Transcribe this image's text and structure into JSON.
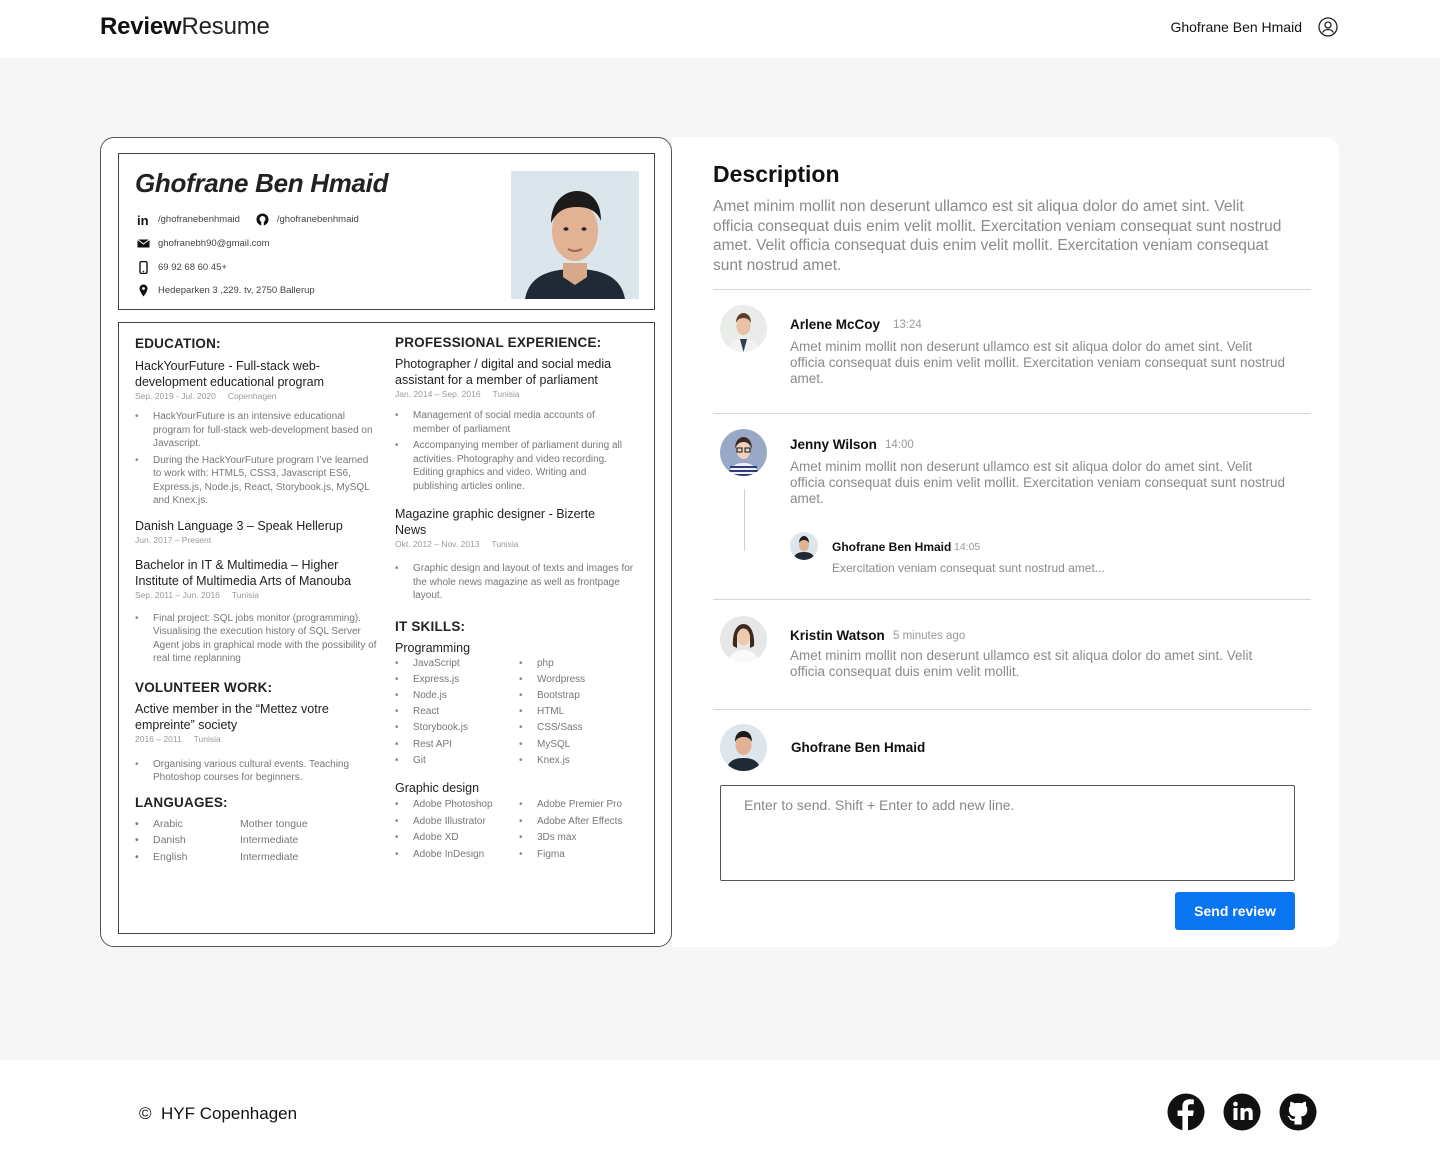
{
  "header": {
    "logo_bold": "Review",
    "logo_light": "Resume",
    "user_name": "Ghofrane Ben Hmaid"
  },
  "resume": {
    "name": "Ghofrane Ben Hmaid",
    "linkedin": "/ghofranebenhmaid",
    "github": "/ghofranebenhmaid",
    "email": "ghofranebh90@gmail.com",
    "phone": "69 92 68 60 45+",
    "address": "Hedeparken 3 ,229. tv, 2750 Ballerup",
    "education_title": "EDUCATION:",
    "edu1_title": "HackYourFuture - Full-stack web-development educational program",
    "edu1_date": "Sep. 2019 - Jul. 2020",
    "edu1_place": "Copenhagen",
    "edu1_b1": "HackYourFuture is an intensive educational program for full-stack web-development based on Javascript.",
    "edu1_b2": "During the HackYourFuture program I’ve learned to work with: HTML5, CSS3, Javascript ES6, Express.js, Node.js, React, Storybook.js, MySQL and Knex.js.",
    "edu2_title": "Danish Language 3 – Speak Hellerup",
    "edu2_date": "Jun. 2017 – Present",
    "edu3_title": "Bachelor in IT &  Multimedia – Higher Institute of Multimedia Arts of Manouba",
    "edu3_date": "Sep. 2011 – Jun. 2016",
    "edu3_place": "Tunisia",
    "edu3_b1": "Final project: SQL jobs monitor (programming). Visualising the execution history of SQL Server Agent jobs in graphical mode with the possibility of real time replanning",
    "volunteer_title": "VOLUNTEER WORK:",
    "vol_title": "Active member in the “Mettez votre empreinte” society",
    "vol_date": "2016 – 2011",
    "vol_place": "Tunisia",
    "vol_b1": "Organising various cultural events. Teaching Photoshop courses for beginners.",
    "languages_title": "LANGUAGES:",
    "languages": [
      {
        "lang": "Arabic",
        "level": "Mother tongue"
      },
      {
        "lang": "Danish",
        "level": "Intermediate"
      },
      {
        "lang": "English",
        "level": "Intermediate"
      }
    ],
    "experience_title": "PROFESSIONAL EXPERIENCE:",
    "exp1_title": "Photographer / digital and social media assistant for a member of parliament",
    "exp1_date": "Jan. 2014 – Sep. 2016",
    "exp1_place": "Tunisia",
    "exp1_b1": "Management of social media accounts of member of parliament",
    "exp1_b2": "Accompanying member of parliament during all activities. Photography and video recording. Editing graphics and video. Writing and publishing articles online.",
    "exp2_title": "Magazine graphic designer - Bizerte News",
    "exp2_date": "Okt. 2012 – Nov. 2013",
    "exp2_place": "Tunisia",
    "exp2_b1": "Graphic design and layout of texts and images for the whole news magazine as well as frontpage layout.",
    "skills_title": "IT SKILLS:",
    "programming_title": "Programming",
    "prog_col1": [
      "JavaScript",
      "Express.js",
      "Node.js",
      "React",
      "Storybook.js",
      "Rest API",
      "Git"
    ],
    "prog_col2": [
      "php",
      "Wordpress",
      "Bootstrap",
      "HTML",
      "CSS/Sass",
      "MySQL",
      "Knex.js"
    ],
    "graphic_title": "Graphic design",
    "gfx_col1": [
      "Adobe Photoshop",
      "Adobe Illustrator",
      "Adobe XD",
      "Adobe InDesign"
    ],
    "gfx_col2": [
      "Adobe Premier Pro",
      "Adobe After Effects",
      "3Ds max",
      "Figma"
    ]
  },
  "review": {
    "description_title": "Description",
    "description_text": "Amet minim mollit non deserunt ullamco est sit aliqua dolor do amet sint. Velit officia consequat duis enim velit mollit. Exercitation veniam consequat sunt nostrud amet. Velit officia consequat duis enim velit mollit. Exercitation veniam consequat sunt nostrud amet.",
    "comments": [
      {
        "name": "Arlene McCoy",
        "time": "13:24",
        "text": "Amet minim mollit non deserunt ullamco est sit aliqua dolor do amet sint. Velit officia consequat duis enim velit mollit. Exercitation veniam consequat sunt nostrud amet."
      },
      {
        "name": "Jenny Wilson",
        "time": "14:00",
        "text": "Amet minim mollit non deserunt ullamco est sit aliqua dolor do amet sint. Velit officia consequat duis enim velit mollit. Exercitation veniam consequat sunt nostrud amet."
      },
      {
        "name": "Kristin Watson",
        "time": "5 minutes ago",
        "text": "Amet minim mollit non deserunt ullamco est sit aliqua dolor do amet sint. Velit officia consequat duis enim velit mollit."
      }
    ],
    "reply": {
      "name": "Ghofrane Ben Hmaid",
      "time": "14:05",
      "text": "Exercitation veniam consequat sunt nostrud amet..."
    },
    "composer_name": "Ghofrane Ben Hmaid",
    "input_placeholder": "Enter to send. Shift + Enter to add new line.",
    "send_label": "Send review"
  },
  "footer": {
    "copyright_symbol": "©",
    "copyright_text": "HYF Copenhagen",
    "social_icons": [
      "facebook-icon",
      "linkedin-icon",
      "github-icon"
    ]
  },
  "colors": {
    "accent": "#0a75f0",
    "muted_text": "#8a8a8a"
  }
}
